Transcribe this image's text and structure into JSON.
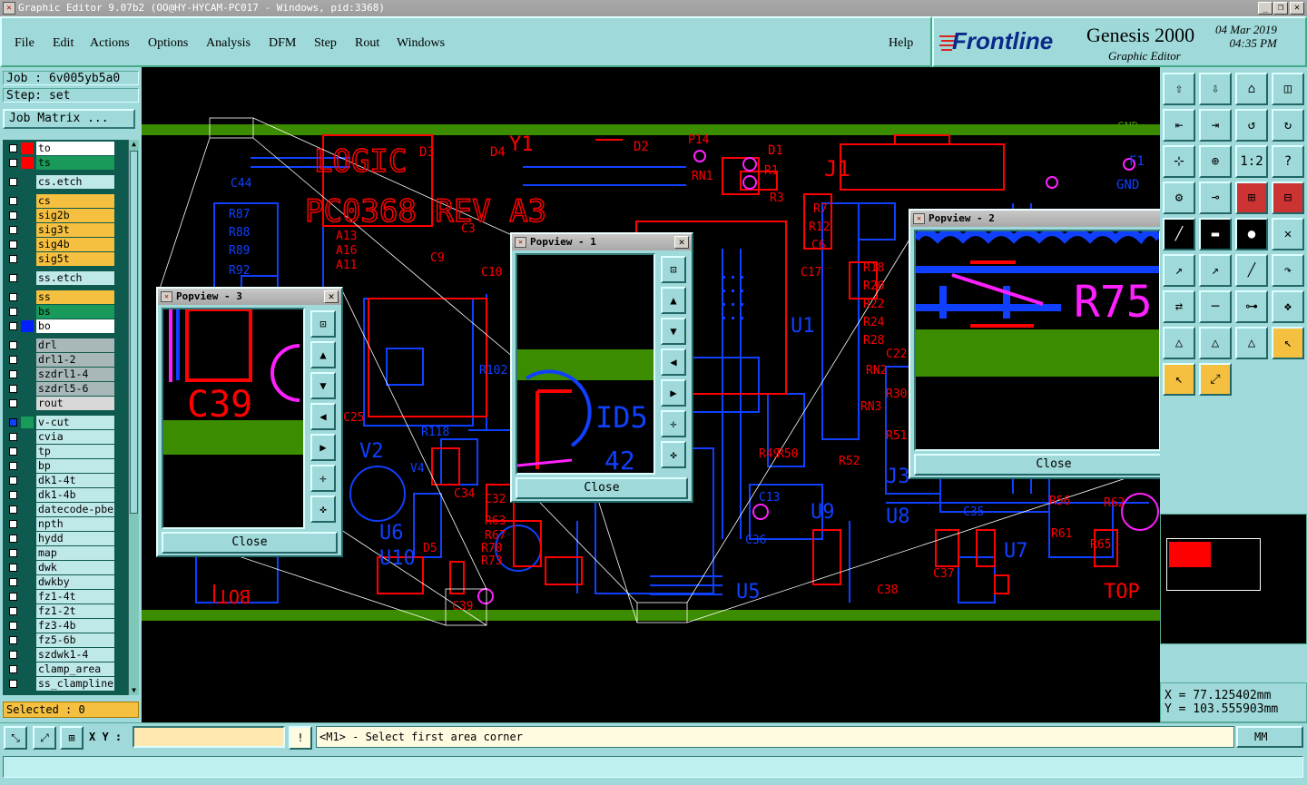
{
  "window": {
    "title": "Graphic Editor 9.07b2 (OO@HY-HYCAM-PC017 - Windows, pid:3368)",
    "min": "_",
    "max": "❒",
    "close": "✕"
  },
  "menu": {
    "file": "File",
    "edit": "Edit",
    "actions": "Actions",
    "options": "Options",
    "analysis": "Analysis",
    "dfm": "DFM",
    "step": "Step",
    "rout": "Rout",
    "windows": "Windows",
    "help": "Help"
  },
  "brand": {
    "logo": "Frontline",
    "product": "Genesis 2000",
    "subtitle": "Graphic Editor",
    "date": "04 Mar 2019",
    "time": "04:35 PM"
  },
  "job": {
    "job_line": "Job : 6v005yb5a0",
    "step_line": "Step: set",
    "matrix_button": "Job Matrix ..."
  },
  "layers": [
    {
      "name": "to",
      "color": "#ff0000",
      "bg": "#ffffff",
      "checked": false
    },
    {
      "name": "ts",
      "color": "#ff0000",
      "bg": "#1a9a5a",
      "checked": false
    },
    {
      "name": "cs.etch",
      "color": "",
      "bg": "#bfe8e8",
      "checked": false
    },
    {
      "name": "cs",
      "color": "",
      "bg": "#f5c040",
      "checked": false
    },
    {
      "name": "sig2b",
      "color": "",
      "bg": "#f5c040",
      "checked": false
    },
    {
      "name": "sig3t",
      "color": "",
      "bg": "#f5c040",
      "checked": false
    },
    {
      "name": "sig4b",
      "color": "",
      "bg": "#f5c040",
      "checked": false
    },
    {
      "name": "sig5t",
      "color": "",
      "bg": "#f5c040",
      "checked": false
    },
    {
      "name": "ss.etch",
      "color": "",
      "bg": "#bfe8e8",
      "checked": false
    },
    {
      "name": "ss",
      "color": "",
      "bg": "#f5c040",
      "checked": false
    },
    {
      "name": "bs",
      "color": "",
      "bg": "#1a9a5a",
      "checked": false
    },
    {
      "name": "bo",
      "color": "#0020ff",
      "bg": "#ffffff",
      "checked": false
    },
    {
      "name": "drl",
      "color": "",
      "bg": "#a8b8b8",
      "checked": false
    },
    {
      "name": "drl1-2",
      "color": "",
      "bg": "#a8b8b8",
      "checked": false
    },
    {
      "name": "szdrl1-4",
      "color": "",
      "bg": "#a8b8b8",
      "checked": false
    },
    {
      "name": "szdrl5-6",
      "color": "",
      "bg": "#a8b8b8",
      "checked": false
    },
    {
      "name": "rout",
      "color": "",
      "bg": "#d8d8d8",
      "checked": false
    },
    {
      "name": "v-cut",
      "color": "#1a9a5a",
      "bg": "#bfe8e8",
      "checked": true
    },
    {
      "name": "cvia",
      "color": "",
      "bg": "#bfe8e8",
      "checked": false
    },
    {
      "name": "tp",
      "color": "",
      "bg": "#bfe8e8",
      "checked": false
    },
    {
      "name": "bp",
      "color": "",
      "bg": "#bfe8e8",
      "checked": false
    },
    {
      "name": "dk1-4t",
      "color": "",
      "bg": "#bfe8e8",
      "checked": false
    },
    {
      "name": "dk1-4b",
      "color": "",
      "bg": "#bfe8e8",
      "checked": false
    },
    {
      "name": "datecode-pbe",
      "color": "",
      "bg": "#bfe8e8",
      "checked": false
    },
    {
      "name": "npth",
      "color": "",
      "bg": "#bfe8e8",
      "checked": false
    },
    {
      "name": "hydd",
      "color": "",
      "bg": "#bfe8e8",
      "checked": false
    },
    {
      "name": "map",
      "color": "",
      "bg": "#bfe8e8",
      "checked": false
    },
    {
      "name": "dwk",
      "color": "",
      "bg": "#bfe8e8",
      "checked": false
    },
    {
      "name": "dwkby",
      "color": "",
      "bg": "#bfe8e8",
      "checked": false
    },
    {
      "name": "fz1-4t",
      "color": "",
      "bg": "#bfe8e8",
      "checked": false
    },
    {
      "name": "fz1-2t",
      "color": "",
      "bg": "#bfe8e8",
      "checked": false
    },
    {
      "name": "fz3-4b",
      "color": "",
      "bg": "#bfe8e8",
      "checked": false
    },
    {
      "name": "fz5-6b",
      "color": "",
      "bg": "#bfe8e8",
      "checked": false
    },
    {
      "name": "szdwk1-4",
      "color": "",
      "bg": "#bfe8e8",
      "checked": false
    },
    {
      "name": "clamp_area",
      "color": "",
      "bg": "#bfe8e8",
      "checked": false
    },
    {
      "name": "ss_clampline",
      "color": "",
      "bg": "#bfe8e8",
      "checked": false
    }
  ],
  "selected": "Selected : 0",
  "canvas_labels": {
    "logic": "LOGIC",
    "board": "PC0368 REV A3",
    "bot": "BOT",
    "top": "TOP",
    "gnd_left": "GND",
    "gnd_right": "GND",
    "j1": "J1",
    "u1": "U1",
    "u5": "U5",
    "u6": "U6",
    "u8": "U8",
    "u9": "U9",
    "u10": "U10",
    "u7": "U7",
    "j3": "J3",
    "v2": "V2",
    "y1": "Y1",
    "d3": "D3",
    "d4": "D4",
    "d1": "D1",
    "d2": "D2",
    "c39": "C39",
    "c32": "C32",
    "c34": "C34",
    "r52": "R52",
    "r62": "R62",
    "r18": "R18",
    "r20": "R20",
    "r22": "R22",
    "r24": "R24",
    "r28": "R28",
    "c22": "C22",
    "rn2": "RN2",
    "rn3": "RN3",
    "r30": "R30",
    "r51": "R51",
    "c17": "C17",
    "r12": "R12",
    "r7": "R7",
    "c6": "C6",
    "r3": "R3",
    "r1": "R1",
    "rn1": "RN1",
    "p14": "P14",
    "c9": "C9",
    "c10": "C10",
    "c3": "C3",
    "a13": "A13",
    "a16": "A16",
    "a11": "A11",
    "c25": "C25",
    "r118": "R118",
    "r102": "R102",
    "r56": "R56",
    "r63": "R63",
    "r67": "R67",
    "r70": "R70",
    "r73": "R73",
    "c36": "C36",
    "c38": "C38",
    "c37": "C37",
    "r65": "R65",
    "r61": "R61",
    "c44": "C44",
    "f1": "F1",
    "r88": "R88",
    "r89": "R89",
    "r92": "R92",
    "r87": "R87",
    "v4": "V4",
    "d5": "D5",
    "c3s": "C35",
    "c13": "C13",
    "r50": "R50",
    "r49": "R49"
  },
  "popview3": {
    "title": "Popview - 3",
    "label": "C39",
    "close": "Close"
  },
  "popview1": {
    "title": "Popview - 1",
    "label1": "ID5",
    "label2": "42",
    "close": "Close"
  },
  "popview2": {
    "title": "Popview - 2",
    "label": "R75",
    "close": "Close"
  },
  "toolbar_icons": [
    "home-in-icon",
    "home-out-icon",
    "home-icon",
    "panel-icon",
    "zoom-prev-icon",
    "zoom-next-icon",
    "pan-icon",
    "redraw-icon",
    "fit-icon",
    "center-icon",
    "one-to-one-icon",
    "help-icon",
    "tool-icon",
    "measure-icon",
    "snap-icon",
    "snap2-icon",
    "line-icon",
    "ruler-icon",
    "circle-icon",
    "cross-icon",
    "arc-icon",
    "arc2-icon",
    "slash-icon",
    "curve-icon",
    "flip-icon",
    "minus-icon",
    "zoom-area-icon",
    "group-icon",
    "triangle-icon",
    "triangle2-icon",
    "triangle3-icon",
    "select-icon",
    "select2-icon",
    "connect-icon"
  ],
  "coords": {
    "x": "X = 77.125402mm",
    "y": "Y = 103.555903mm"
  },
  "status": {
    "xy_label": "X Y :",
    "xy_value": "",
    "alert": "!",
    "prompt": "<M1> - Select first area corner",
    "units": "MM"
  },
  "colors": {
    "panel": "#9fd9d9",
    "canvas": "#000000",
    "red": "#ff0000",
    "blue": "#1040ff",
    "green": "#3c8c00",
    "magenta": "#ff20ff"
  }
}
